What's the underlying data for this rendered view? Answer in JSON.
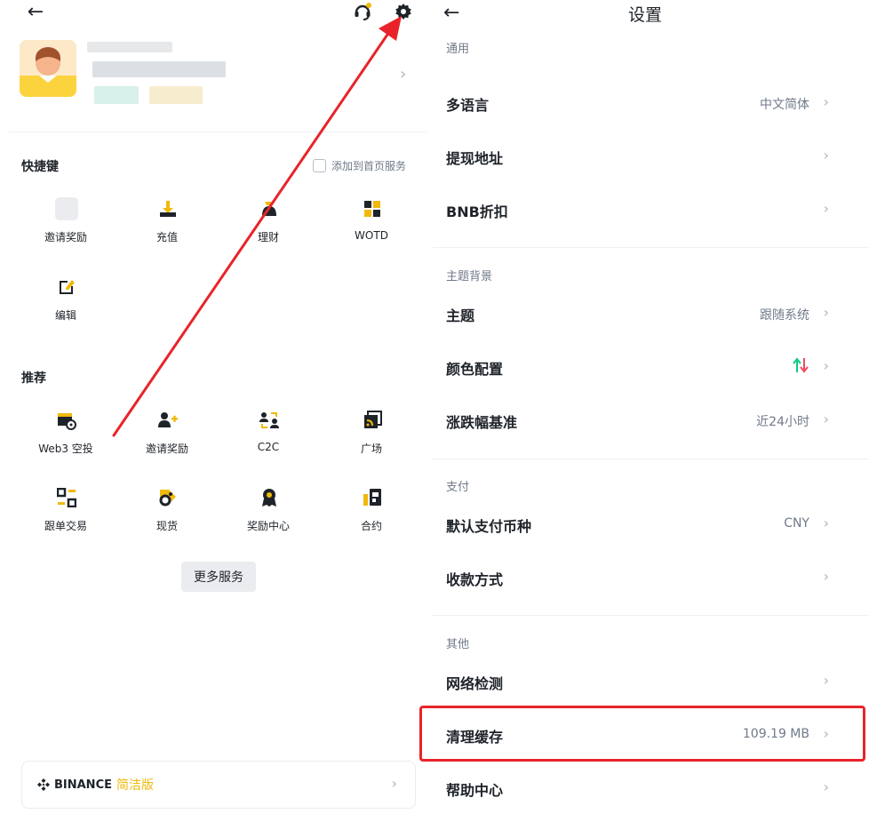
{
  "left": {
    "shortcuts": {
      "title": "快捷键",
      "add_to_home": "添加到首页服务",
      "items": [
        {
          "label": "邀请奖励",
          "icon": "placeholder-icon"
        },
        {
          "label": "充值",
          "icon": "deposit-icon"
        },
        {
          "label": "理财",
          "icon": "earn-icon"
        },
        {
          "label": "WOTD",
          "icon": "wotd-icon"
        },
        {
          "label": "编辑",
          "icon": "edit-icon"
        }
      ]
    },
    "recommend": {
      "title": "推荐",
      "items": [
        {
          "label": "Web3 空投",
          "icon": "airdrop-calendar-icon"
        },
        {
          "label": "邀请奖励",
          "icon": "invite-user-icon"
        },
        {
          "label": "C2C",
          "icon": "c2c-icon"
        },
        {
          "label": "广场",
          "icon": "square-feed-icon"
        },
        {
          "label": "跟单交易",
          "icon": "copy-trading-icon"
        },
        {
          "label": "现货",
          "icon": "spot-icon"
        },
        {
          "label": "奖励中心",
          "icon": "reward-badge-icon"
        },
        {
          "label": "合约",
          "icon": "futures-icon"
        }
      ]
    },
    "more_services": "更多服务",
    "lite": {
      "brand": "BINANCE",
      "tag": "简洁版"
    }
  },
  "right": {
    "title": "设置",
    "groups": [
      {
        "title": "通用",
        "rows": [
          {
            "label": "多语言",
            "value": "中文简体"
          },
          {
            "label": "提现地址",
            "value": ""
          },
          {
            "label": "BNB折扣",
            "value": ""
          }
        ]
      },
      {
        "title": "主题背景",
        "rows": [
          {
            "label": "主题",
            "value": "跟随系统"
          },
          {
            "label": "颜色配置",
            "value": ""
          },
          {
            "label": "涨跌幅基准",
            "value": "近24小时"
          }
        ]
      },
      {
        "title": "支付",
        "rows": [
          {
            "label": "默认支付币种",
            "value": "CNY"
          },
          {
            "label": "收款方式",
            "value": ""
          }
        ]
      },
      {
        "title": "其他",
        "rows": [
          {
            "label": "网络检测",
            "value": ""
          },
          {
            "label": "清理缓存",
            "value": "109.19 MB"
          },
          {
            "label": "帮助中心",
            "value": ""
          }
        ]
      }
    ]
  },
  "colors": {
    "brand_yellow": "#F0B90B",
    "annotation_red": "#E8242A",
    "up_green": "#0ECB81",
    "down_red": "#F6465D"
  }
}
